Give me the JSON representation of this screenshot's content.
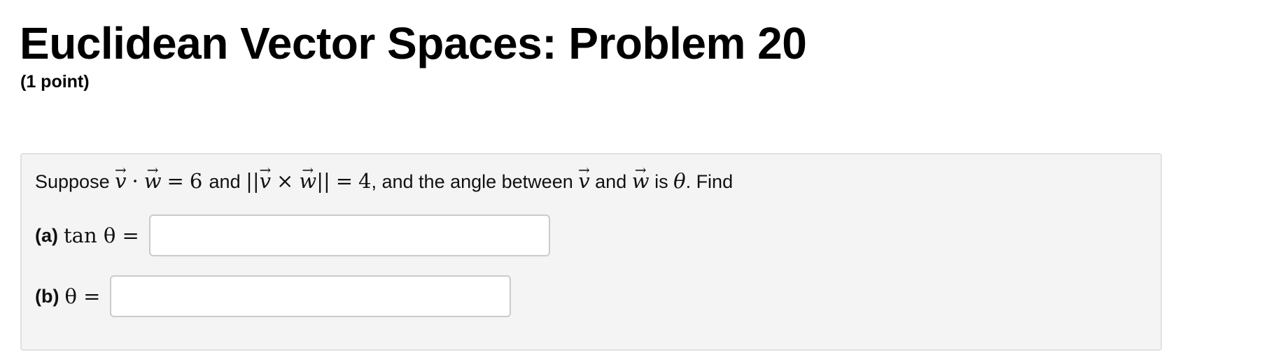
{
  "page": {
    "title": "Euclidean Vector Spaces: Problem 20",
    "points": "(1 point)"
  },
  "problem": {
    "intro_prefix": "Suppose",
    "dot_value": "6",
    "word_and": "and",
    "cross_norm_value": "4",
    "angle_text": ", and the angle between",
    "word_and_2": "and",
    "word_is": "is",
    "find_text": ". Find",
    "vector_v": "v",
    "vector_w": "w",
    "theta": "θ"
  },
  "parts": [
    {
      "label": "(a)",
      "expression": "tan θ =",
      "value": "",
      "placeholder": ""
    },
    {
      "label": "(b)",
      "expression": "θ =",
      "value": "",
      "placeholder": ""
    }
  ]
}
